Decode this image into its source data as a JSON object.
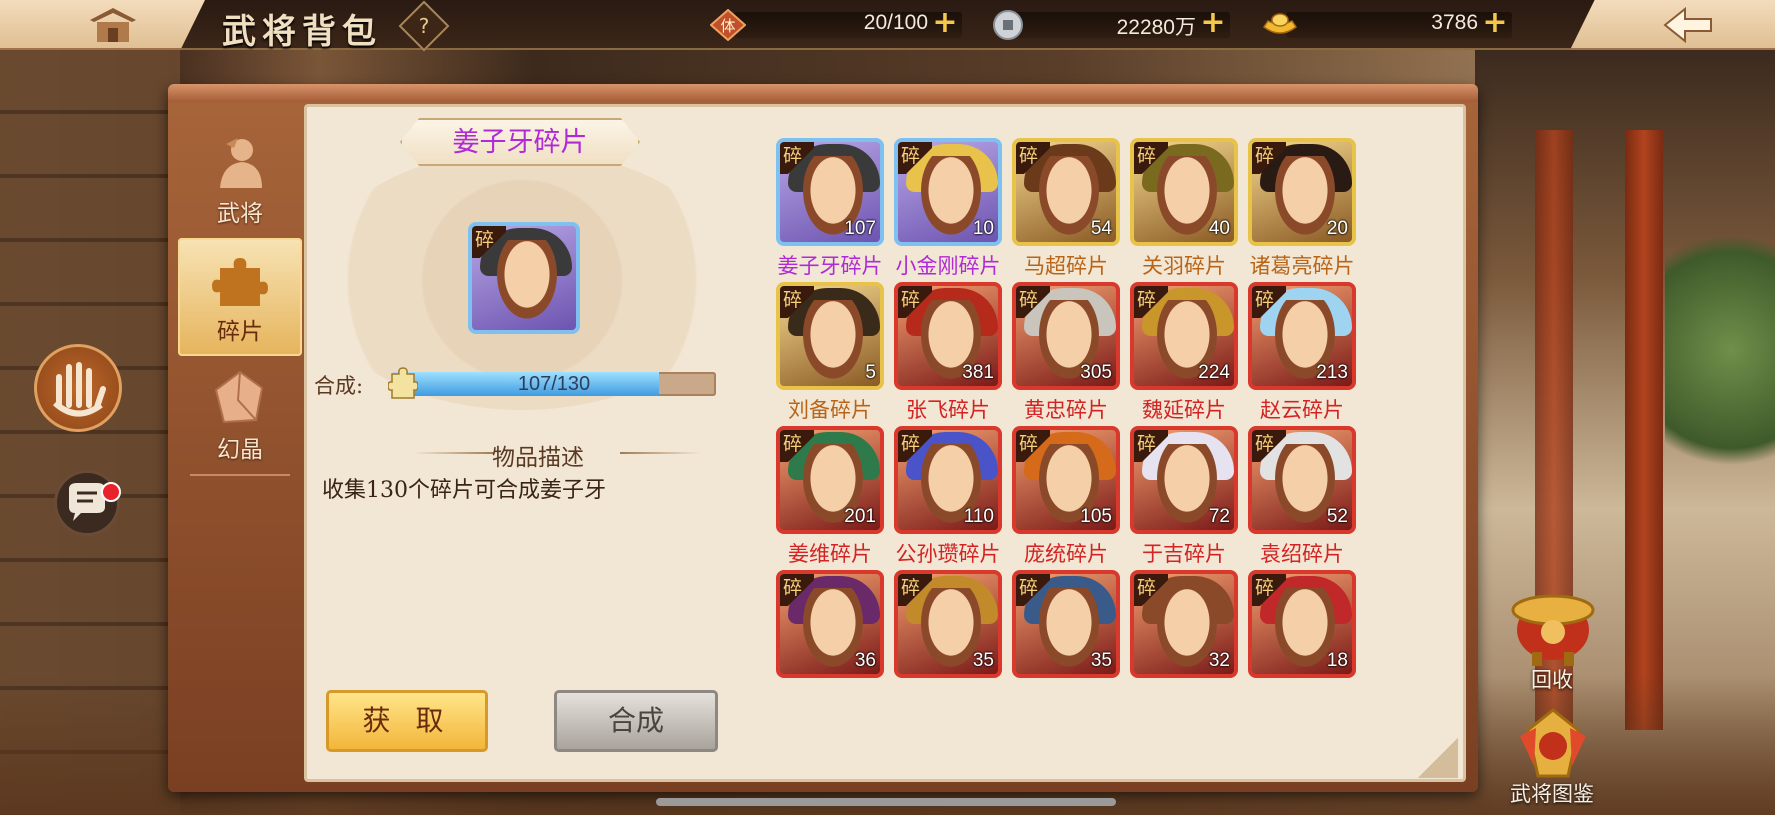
{
  "topbar": {
    "title": "武将背包",
    "help_label": "?",
    "stamina": {
      "icon": "stamina-icon",
      "icon_text": "体",
      "value": "20/100",
      "plus": "+"
    },
    "coins": {
      "icon": "coin-icon",
      "value": "22280万",
      "plus": "+"
    },
    "ingots": {
      "icon": "gold-ingot-icon",
      "value": "3786",
      "plus": "+"
    }
  },
  "tabs": [
    {
      "label": "武将",
      "icon": "general-silhouette-icon",
      "active": false
    },
    {
      "label": "碎片",
      "icon": "puzzle-piece-icon",
      "active": true
    },
    {
      "label": "幻晶",
      "icon": "crystal-icon",
      "active": false
    }
  ],
  "detail": {
    "title": "姜子牙碎片",
    "synth_label": "合成:",
    "progress_text": "107/130",
    "progress": {
      "current": 107,
      "total": 130
    },
    "desc_header": "物品描述",
    "desc_text": "收集130个碎片可合成姜子牙",
    "acquire_label": "获 取",
    "synth_button_label": "合成"
  },
  "fragment_tag": "碎",
  "fragments": [
    {
      "name": "姜子牙碎片",
      "count": "107",
      "quality": "purple",
      "name_color": "#b02bd4",
      "hair": "#3a3a3a"
    },
    {
      "name": "小金刚碎片",
      "count": "10",
      "quality": "purple",
      "name_color": "#b02bd4",
      "hair": "#e8c24a"
    },
    {
      "name": "马超碎片",
      "count": "54",
      "quality": "gold",
      "name_color": "#b8651a",
      "hair": "#6a3a1a"
    },
    {
      "name": "关羽碎片",
      "count": "40",
      "quality": "gold",
      "name_color": "#b8651a",
      "hair": "#7a6a20"
    },
    {
      "name": "诸葛亮碎片",
      "count": "20",
      "quality": "gold",
      "name_color": "#b8651a",
      "hair": "#2a1a14"
    },
    {
      "name": "刘备碎片",
      "count": "5",
      "quality": "gold",
      "name_color": "#b8651a",
      "hair": "#3a2a1a"
    },
    {
      "name": "张飞碎片",
      "count": "381",
      "quality": "red",
      "name_color": "#d42323",
      "hair": "#b62a1c"
    },
    {
      "name": "黄忠碎片",
      "count": "305",
      "quality": "red",
      "name_color": "#d42323",
      "hair": "#c9c4bc"
    },
    {
      "name": "魏延碎片",
      "count": "224",
      "quality": "red",
      "name_color": "#d42323",
      "hair": "#c8962a"
    },
    {
      "name": "赵云碎片",
      "count": "213",
      "quality": "red",
      "name_color": "#d42323",
      "hair": "#9ed4f0"
    },
    {
      "name": "姜维碎片",
      "count": "201",
      "quality": "red",
      "name_color": "#d42323",
      "hair": "#2f7a4a"
    },
    {
      "name": "公孙瓒碎片",
      "count": "110",
      "quality": "red",
      "name_color": "#d42323",
      "hair": "#4a54c8"
    },
    {
      "name": "庞统碎片",
      "count": "105",
      "quality": "red",
      "name_color": "#d42323",
      "hair": "#d46a1a"
    },
    {
      "name": "于吉碎片",
      "count": "72",
      "quality": "red",
      "name_color": "#d42323",
      "hair": "#e6e2f0"
    },
    {
      "name": "袁绍碎片",
      "count": "52",
      "quality": "red",
      "name_color": "#d42323",
      "hair": "#e2e2e2"
    },
    {
      "name": "",
      "count": "36",
      "quality": "red",
      "name_color": "#d42323",
      "hair": "#6a2a6a"
    },
    {
      "name": "",
      "count": "35",
      "quality": "red",
      "name_color": "#d42323",
      "hair": "#c28a2a"
    },
    {
      "name": "",
      "count": "35",
      "quality": "red",
      "name_color": "#d42323",
      "hair": "#3a5a8a"
    },
    {
      "name": "",
      "count": "32",
      "quality": "red",
      "name_color": "#d42323",
      "hair": "#8a4a2a"
    },
    {
      "name": "",
      "count": "18",
      "quality": "red",
      "name_color": "#d42323",
      "hair": "#c0282a"
    }
  ],
  "side": {
    "recycle_label": "回收",
    "album_label": "武将图鉴"
  }
}
